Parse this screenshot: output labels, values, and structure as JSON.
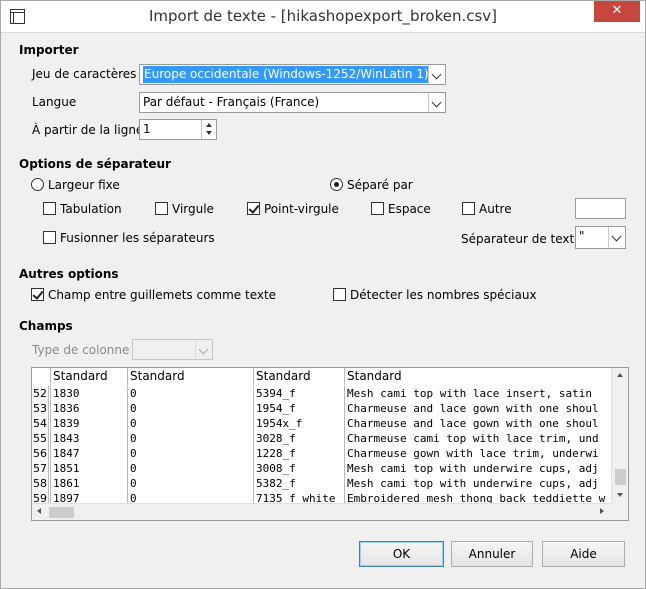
{
  "window": {
    "title": "Import de texte - [hikashopexport_broken.csv]",
    "close_label": "✕"
  },
  "importer": {
    "section": "Importer",
    "charset_label": "Jeu de caractères",
    "charset_value": "Europe occidentale (Windows-1252/WinLatin 1)",
    "language_label": "Langue",
    "language_value": "Par défaut - Français (France)",
    "from_line_label": "À partir de la ligne",
    "from_line_value": "1"
  },
  "separator_options": {
    "section": "Options de séparateur",
    "fixed_width_label": "Largeur fixe",
    "fixed_width_checked": false,
    "separated_by_label": "Séparé par",
    "separated_by_checked": true,
    "tab_label": "Tabulation",
    "tab_checked": false,
    "comma_label": "Virgule",
    "comma_checked": false,
    "semicolon_label": "Point-virgule",
    "semicolon_checked": true,
    "space_label": "Espace",
    "space_checked": false,
    "other_label": "Autre",
    "other_checked": false,
    "other_value": "",
    "merge_label": "Fusionner les séparateurs",
    "merge_checked": false,
    "text_delimiter_label": "Séparateur de texte",
    "text_delimiter_value": "\""
  },
  "other_options": {
    "section": "Autres options",
    "quoted_as_text_label": "Champ entre guillemets comme texte",
    "quoted_as_text_checked": true,
    "detect_special_label": "Détecter les nombres spéciaux",
    "detect_special_checked": false
  },
  "fields": {
    "section": "Champs",
    "column_type_label": "Type de colonne",
    "column_type_value": "",
    "headers": [
      "Standard",
      "Standard",
      "Standard",
      "Standard"
    ],
    "rows": [
      {
        "num": "52",
        "cells": [
          "1830",
          "0",
          "5394_f",
          "Mesh cami top with lace insert, satin"
        ]
      },
      {
        "num": "53",
        "cells": [
          "1836",
          "0",
          "1954_f",
          "Charmeuse and lace gown with one shoul"
        ]
      },
      {
        "num": "54",
        "cells": [
          "1839",
          "0",
          "1954x_f",
          "Charmeuse and lace gown with one shoul"
        ]
      },
      {
        "num": "55",
        "cells": [
          "1843",
          "0",
          "3028_f",
          "Charmeuse cami top with lace trim, und"
        ]
      },
      {
        "num": "56",
        "cells": [
          "1847",
          "0",
          "1228_f",
          "Charmeuse gown with lace trim, underwi"
        ]
      },
      {
        "num": "57",
        "cells": [
          "1851",
          "0",
          "3008_f",
          "Mesh cami top with underwire cups, adj"
        ]
      },
      {
        "num": "58",
        "cells": [
          "1861",
          "0",
          "5382_f",
          "Mesh cami top with underwire cups, adj"
        ]
      },
      {
        "num": "59",
        "cells": [
          "1897",
          "0",
          "7135_f_white",
          "Embroidered mesh thong back teddiette w"
        ]
      }
    ]
  },
  "buttons": {
    "ok": "OK",
    "cancel": "Annuler",
    "help": "Aide"
  }
}
